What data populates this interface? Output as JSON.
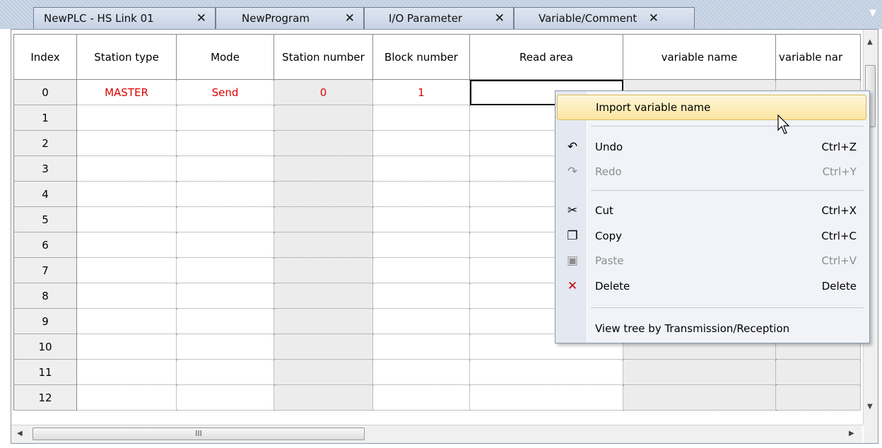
{
  "tabs": [
    {
      "label": "NewPLC - HS Link 01",
      "active": true
    },
    {
      "label": "NewProgram",
      "active": false
    },
    {
      "label": "I/O Parameter",
      "active": false
    },
    {
      "label": "Variable/Comment",
      "active": false
    }
  ],
  "tab_close_glyph": "✕",
  "table": {
    "headers": [
      "Index",
      "Station type",
      "Mode",
      "Station number",
      "Block number",
      "Read area",
      "variable name",
      "variable nar"
    ],
    "rows": [
      {
        "index": "0",
        "station_type": "MASTER",
        "mode": "Send",
        "station_number": "0",
        "block_number": "1"
      },
      {
        "index": "1"
      },
      {
        "index": "2"
      },
      {
        "index": "3"
      },
      {
        "index": "4"
      },
      {
        "index": "5"
      },
      {
        "index": "6"
      },
      {
        "index": "7"
      },
      {
        "index": "8"
      },
      {
        "index": "9"
      },
      {
        "index": "10"
      },
      {
        "index": "11"
      },
      {
        "index": "12"
      }
    ],
    "value_color": "#e00000"
  },
  "context_menu": {
    "items": [
      {
        "label": "Import variable name",
        "shortcut": "",
        "icon": "",
        "enabled": true,
        "highlighted": true
      },
      {
        "label": "Undo",
        "shortcut": "Ctrl+Z",
        "icon": "undo-icon",
        "enabled": true
      },
      {
        "label": "Redo",
        "shortcut": "Ctrl+Y",
        "icon": "redo-icon",
        "enabled": false
      },
      {
        "label": "Cut",
        "shortcut": "Ctrl+X",
        "icon": "scissors-icon",
        "enabled": true
      },
      {
        "label": "Copy",
        "shortcut": "Ctrl+C",
        "icon": "copy-icon",
        "enabled": true
      },
      {
        "label": "Paste",
        "shortcut": "Ctrl+V",
        "icon": "paste-icon",
        "enabled": false
      },
      {
        "label": "Delete",
        "shortcut": "Delete",
        "icon": "delete-x-icon",
        "enabled": true
      },
      {
        "label": "View tree by Transmission/Reception",
        "shortcut": "",
        "icon": "",
        "enabled": true
      }
    ]
  },
  "hscroll_grip": "III"
}
